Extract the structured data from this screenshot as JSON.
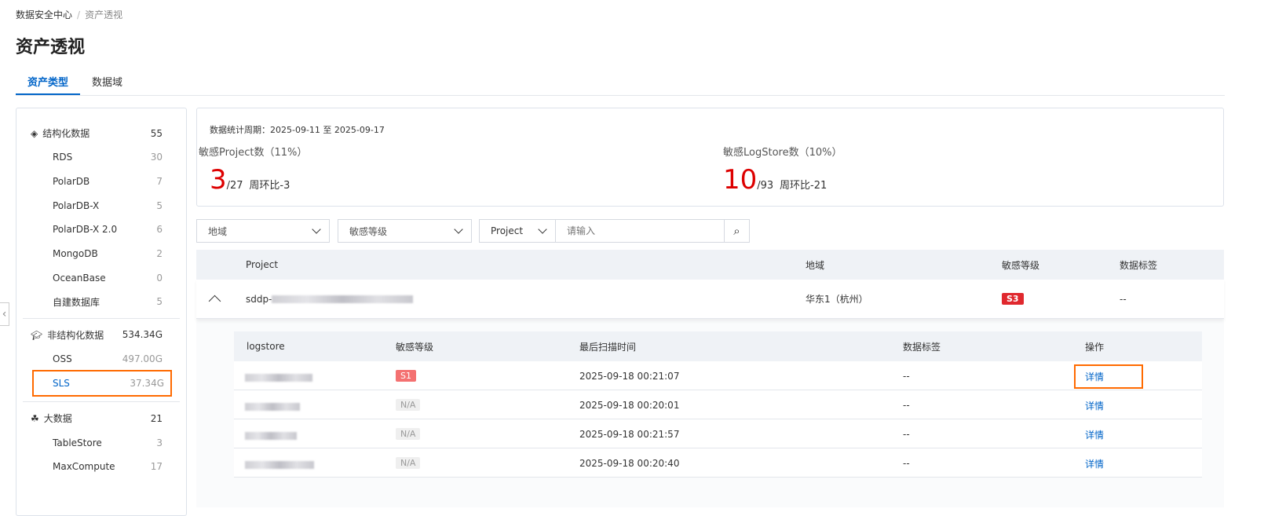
{
  "breadcrumb": {
    "root": "数据安全中心",
    "current": "资产透视"
  },
  "page_title": "资产透视",
  "tabs": [
    {
      "label": "资产类型"
    },
    {
      "label": "数据域"
    }
  ],
  "sidebar": {
    "groups": [
      {
        "label": "结构化数据",
        "count": "55",
        "icon": "layers-icon",
        "items": [
          {
            "label": "RDS",
            "count": "30"
          },
          {
            "label": "PolarDB",
            "count": "7"
          },
          {
            "label": "PolarDB-X",
            "count": "5"
          },
          {
            "label": "PolarDB-X 2.0",
            "count": "6"
          },
          {
            "label": "MongoDB",
            "count": "2"
          },
          {
            "label": "OceanBase",
            "count": "0"
          },
          {
            "label": "自建数据库",
            "count": "5"
          }
        ]
      },
      {
        "label": "非结构化数据",
        "count": "534.34G",
        "icon": "graduation-cap-icon",
        "items": [
          {
            "label": "OSS",
            "count": "497.00G"
          },
          {
            "label": "SLS",
            "count": "37.34G"
          }
        ]
      },
      {
        "label": "大数据",
        "count": "21",
        "icon": "cubes-icon",
        "items": [
          {
            "label": "TableStore",
            "count": "3"
          },
          {
            "label": "MaxCompute",
            "count": "17"
          }
        ]
      }
    ]
  },
  "stats": {
    "period": "数据统计周期：2025-09-11 至 2025-09-17",
    "project": {
      "label": "敏感Project数（11%）",
      "value": "3",
      "total": "/27",
      "wow": "周环比-3"
    },
    "logstore": {
      "label": "敏感LogStore数（10%）",
      "value": "10",
      "total": "/93",
      "wow": "周环比-21"
    }
  },
  "filters": {
    "region": "地域",
    "level": "敏感等级",
    "type": "Project",
    "search_placeholder": "请输入"
  },
  "table": {
    "headers": [
      "Project",
      "地域",
      "敏感等级",
      "数据标签"
    ],
    "row": {
      "project": "sddp-",
      "region": "华东1（杭州）",
      "level": "S3",
      "tags": "--"
    },
    "sub": {
      "headers": [
        "logstore",
        "敏感等级",
        "最后扫描时间",
        "数据标签",
        "操作"
      ],
      "rows": [
        {
          "level": "S1",
          "time": "2025-09-18 00:21:07",
          "tags": "--",
          "action": "详情"
        },
        {
          "level": "N/A",
          "time": "2025-09-18 00:20:01",
          "tags": "--",
          "action": "详情"
        },
        {
          "level": "N/A",
          "time": "2025-09-18 00:21:57",
          "tags": "--",
          "action": "详情"
        },
        {
          "level": "N/A",
          "time": "2025-09-18 00:20:40",
          "tags": "--",
          "action": "详情"
        }
      ]
    }
  },
  "colors": {
    "accent": "#0064c8",
    "danger": "#d00000",
    "highlight": "#ff6a00"
  }
}
